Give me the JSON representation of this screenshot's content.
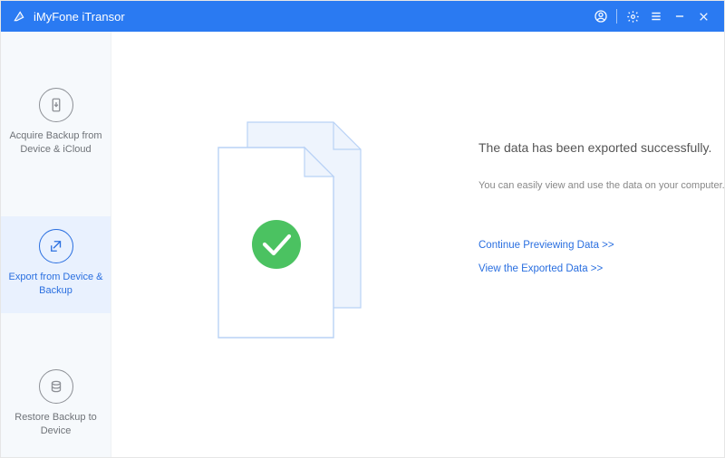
{
  "app": {
    "title": "iMyFone iTransor"
  },
  "titlebar": {
    "icons": {
      "account": "account-icon",
      "settings": "gear-icon",
      "menu": "menu-icon",
      "minimize": "minimize-icon",
      "close": "close-icon"
    }
  },
  "sidebar": {
    "items": [
      {
        "label": "Acquire Backup from Device & iCloud",
        "icon": "phone-download-icon",
        "active": false
      },
      {
        "label": "Export from Device & Backup",
        "icon": "export-icon",
        "active": true
      },
      {
        "label": "Restore Backup to Device",
        "icon": "restore-icon",
        "active": false
      }
    ]
  },
  "main": {
    "heading": "The data has been exported successfully.",
    "subtext": "You can easily view and use the data on your computer.",
    "links": {
      "continue": "Continue Previewing Data >>",
      "view": "View the Exported Data >>"
    },
    "status_icon": "check-icon"
  }
}
